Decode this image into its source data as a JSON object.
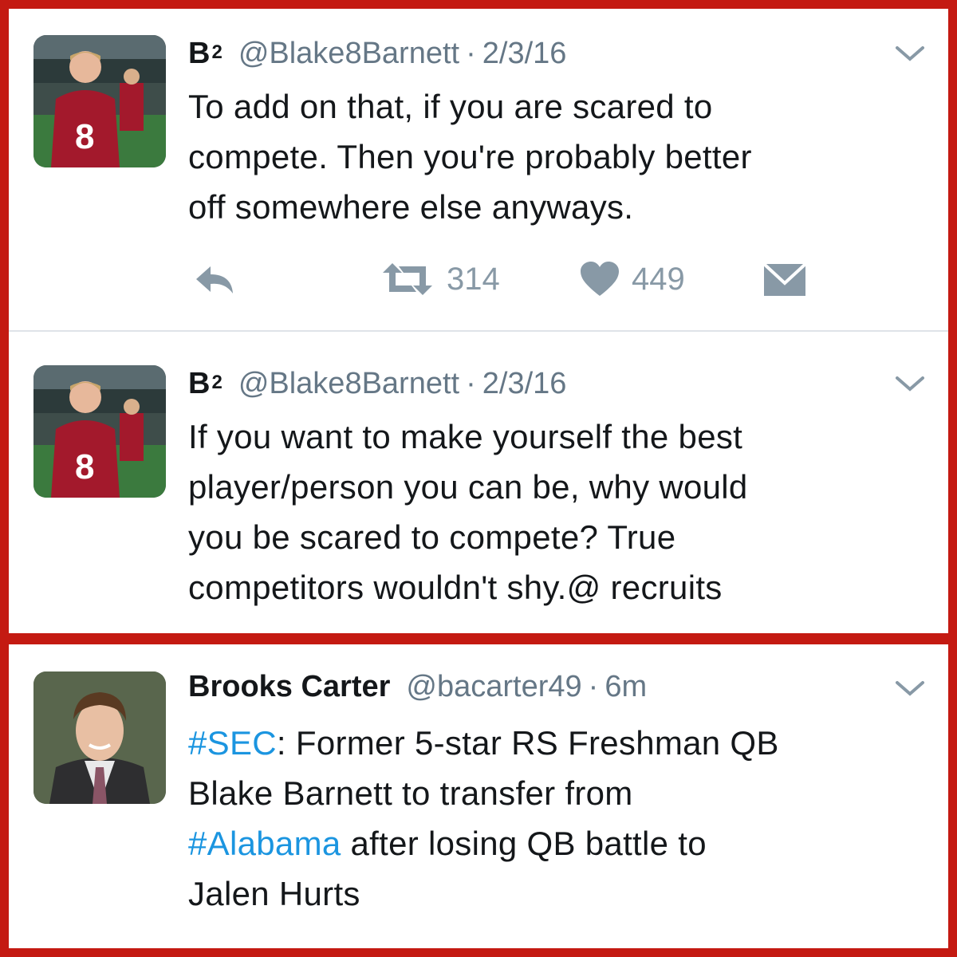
{
  "tweets": [
    {
      "name": "B",
      "name_sup": "2",
      "handle": "@Blake8Barnett",
      "separator": "·",
      "date": "2/3/16",
      "text": "To add on that, if you are scared to compete. Then you're probably better off somewhere else anyways.",
      "text_lines": [
        "To add on that, if you are scared to",
        "compete. Then you're probably better",
        "off somewhere else anyways."
      ],
      "actions": {
        "retweets": "314",
        "likes": "449"
      }
    },
    {
      "name": "B",
      "name_sup": "2",
      "handle": "@Blake8Barnett",
      "separator": "·",
      "date": "2/3/16",
      "text_lines": [
        "If you want to make yourself the best",
        "player/person you can be, why would",
        "you be scared to compete? True",
        "competitors wouldn't shy.@ recruits"
      ]
    },
    {
      "name": "Brooks Carter",
      "handle": "@bacarter49",
      "separator": "·",
      "date": "6m",
      "hashtag_sec": "#SEC",
      "line1_rest": ": Former 5-star RS Freshman QB",
      "line2": "Blake Barnett to transfer from",
      "hashtag_alabama": "#Alabama",
      "line3_rest": " after losing QB battle to",
      "line4": "Jalen Hurts"
    }
  ],
  "colors": {
    "frame": "#c41a12",
    "link": "#1b95e0",
    "muted": "#657786",
    "icon": "#8899a6"
  },
  "icons": [
    "reply-icon",
    "retweet-icon",
    "heart-icon",
    "dm-icon",
    "chevron-down-icon"
  ]
}
